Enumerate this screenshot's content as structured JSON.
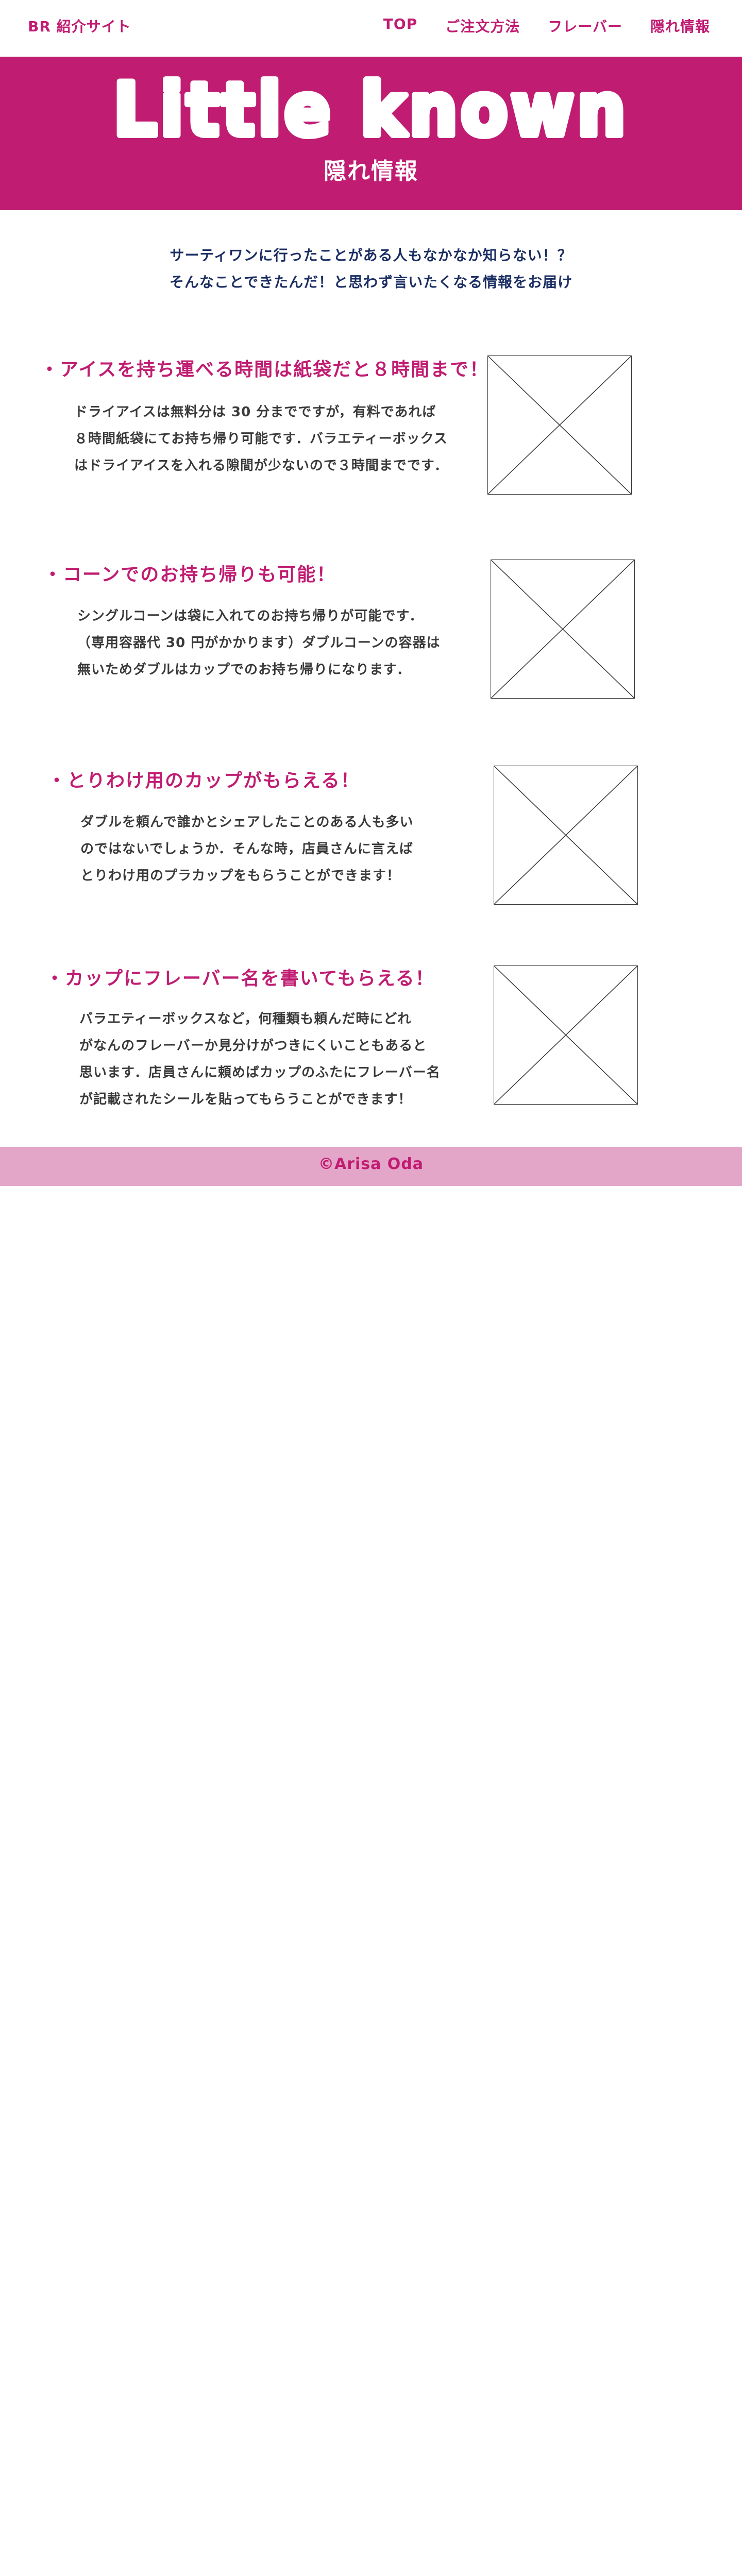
{
  "header": {
    "brand": "BR 紹介サイト",
    "nav": [
      {
        "label": "TOP"
      },
      {
        "label": "ご注文方法"
      },
      {
        "label": "フレーバー"
      },
      {
        "label": "隠れ情報"
      }
    ]
  },
  "hero": {
    "logo_text": "Little known",
    "subtitle": "隠れ情報"
  },
  "intro": {
    "line1": "サーティワンに行ったことがある人もなかなか知らない！？",
    "line2": "そんなことできたんだ！と思わず言いたくなる情報をお届け"
  },
  "sections": [
    {
      "title": "・アイスを持ち運べる時間は紙袋だと８時間まで！",
      "lines": [
        "ドライアイスは無料分は 30 分までですが，有料であれば",
        "８時間紙袋にてお持ち帰り可能です．バラエティーボックス",
        "はドライアイスを入れる隙間が少ないので３時間までです．"
      ]
    },
    {
      "title": "・コーンでのお持ち帰りも可能！",
      "lines": [
        "シングルコーンは袋に入れてのお持ち帰りが可能です．",
        "（専用容器代 30 円がかかります）ダブルコーンの容器は",
        "無いためダブルはカップでのお持ち帰りになります．"
      ]
    },
    {
      "title": "・とりわけ用のカップがもらえる！",
      "lines": [
        "ダブルを頼んで誰かとシェアしたことのある人も多い",
        "のではないでしょうか．そんな時，店員さんに言えば",
        "とりわけ用のプラカップをもらうことができます！"
      ]
    },
    {
      "title": "・カップにフレーバー名を書いてもらえる！",
      "lines": [
        "バラエティーボックスなど，何種類も頼んだ時にどれ",
        "がなんのフレーバーか見分けがつきにくいこともあると",
        "思います．店員さんに頼めばカップのふたにフレーバー名",
        "が記載されたシールを貼ってもらうことができます！"
      ]
    }
  ],
  "footer": {
    "copyright": "©Arisa Oda"
  },
  "colors": {
    "accent": "#c01c72",
    "footer_bg": "#e4a6c8",
    "intro_text": "#1b2e63",
    "body_text": "#3a3a3a"
  }
}
